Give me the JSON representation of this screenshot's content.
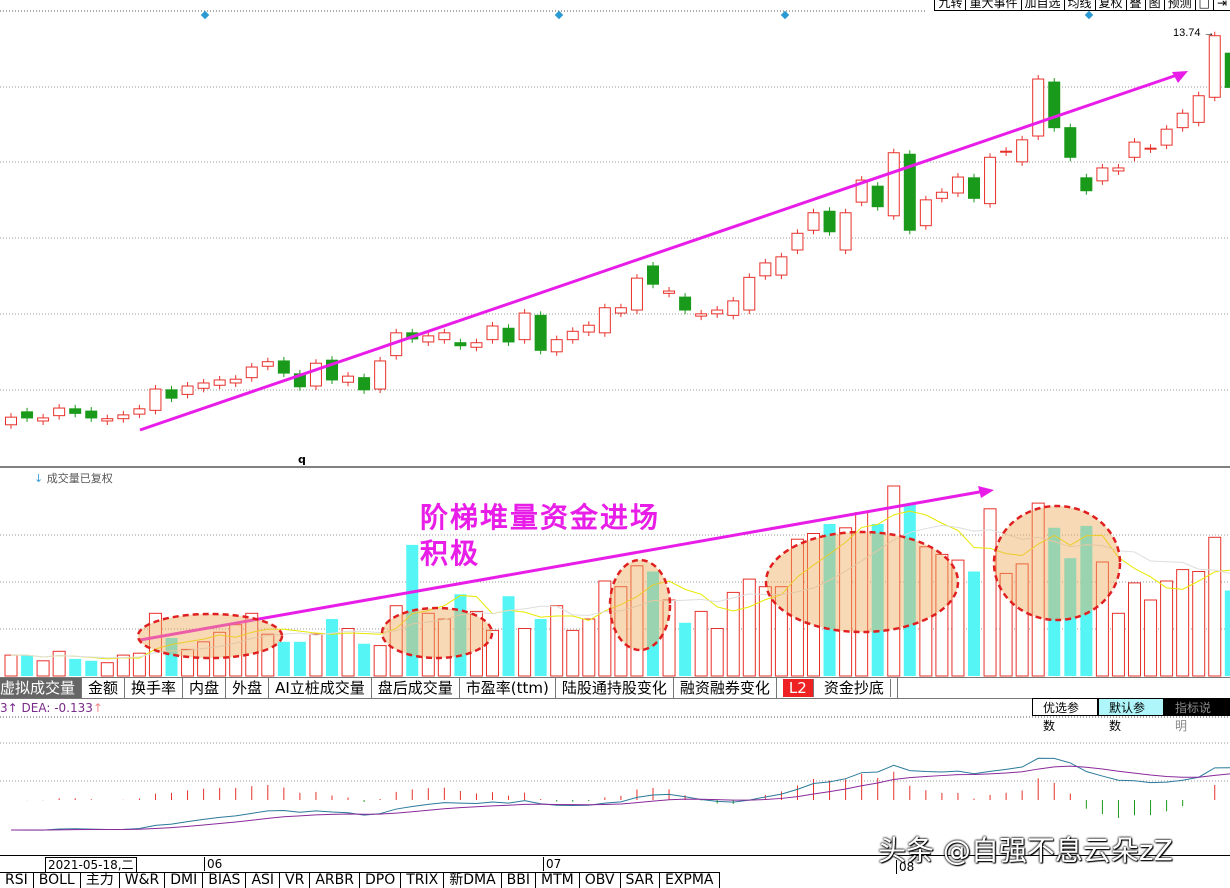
{
  "toolbar": [
    "九转",
    "重大事件",
    "加自选",
    "均线",
    "复权",
    "叠",
    "图",
    "预测",
    "□",
    "⇥"
  ],
  "price": {
    "high_label": "13.74"
  },
  "volume": {
    "note": "成交量已复权",
    "note_icon": "↓"
  },
  "marker": "q",
  "annotations": {
    "line1": "阶梯堆量资金进场",
    "line2": "积极"
  },
  "tabs": [
    "虚拟成交量",
    "金额",
    "换手率",
    "内盘",
    "外盘",
    "AI立桩成交量",
    "盘后成交量",
    "市盈率(ttm)",
    "陆股通持股变化",
    "融资融券变化",
    "资金抄底"
  ],
  "tab_badge": "L2",
  "macd": {
    "dif_tail": "3↑",
    "dea": "DEA: -0.133",
    "dea_arrow": "↑"
  },
  "param_buttons": [
    "优选参数",
    "默认参数",
    "指标说明"
  ],
  "date": {
    "cursor": "2021-05-18,二",
    "ticks": [
      "06",
      "07",
      "08"
    ]
  },
  "bottom_tabs": [
    "RSI",
    "BOLL",
    "主力",
    "W&R",
    "DMI",
    "BIAS",
    "ASI",
    "VR",
    "ARBR",
    "DPO",
    "TRIX",
    "新DMA",
    "BBI",
    "MTM",
    "OBV",
    "SAR",
    "EXPMA"
  ],
  "watermark": "头条 @自强不息云朵zZ",
  "colors": {
    "up": "#e8302a",
    "down": "#1a9a1a",
    "vol_down": "#55f5f5",
    "arrow": "#e81ee8"
  },
  "chart_data": {
    "type": "candlestick",
    "candles_open_close": [
      [
        8.61,
        8.71
      ],
      [
        8.78,
        8.7
      ],
      [
        8.66,
        8.7
      ],
      [
        8.73,
        8.83
      ],
      [
        8.82,
        8.76
      ],
      [
        8.79,
        8.7
      ],
      [
        8.66,
        8.69
      ],
      [
        8.69,
        8.74
      ],
      [
        8.75,
        8.82
      ],
      [
        8.8,
        9.08
      ],
      [
        9.07,
        8.96
      ],
      [
        9.01,
        9.12
      ],
      [
        9.09,
        9.16
      ],
      [
        9.13,
        9.2
      ],
      [
        9.16,
        9.21
      ],
      [
        9.23,
        9.37
      ],
      [
        9.38,
        9.44
      ],
      [
        9.45,
        9.29
      ],
      [
        9.28,
        9.11
      ],
      [
        9.12,
        9.42
      ],
      [
        9.46,
        9.2
      ],
      [
        9.17,
        9.25
      ],
      [
        9.23,
        9.07
      ],
      [
        9.08,
        9.45
      ],
      [
        9.52,
        9.82
      ],
      [
        9.82,
        9.74
      ],
      [
        9.7,
        9.78
      ],
      [
        9.73,
        9.82
      ],
      [
        9.69,
        9.65
      ],
      [
        9.63,
        9.69
      ],
      [
        9.73,
        9.91
      ],
      [
        9.88,
        9.7
      ],
      [
        9.73,
        10.08
      ],
      [
        10.05,
        9.59
      ],
      [
        9.57,
        9.73
      ],
      [
        9.73,
        9.84
      ],
      [
        9.83,
        9.92
      ],
      [
        9.82,
        10.15
      ],
      [
        10.08,
        10.15
      ],
      [
        10.12,
        10.54
      ],
      [
        10.7,
        10.46
      ],
      [
        10.34,
        10.37
      ],
      [
        10.29,
        10.12
      ],
      [
        10.04,
        10.07
      ],
      [
        10.07,
        10.12
      ],
      [
        10.05,
        10.24
      ],
      [
        10.12,
        10.55
      ],
      [
        10.57,
        10.74
      ],
      [
        10.58,
        10.82
      ],
      [
        10.91,
        11.13
      ],
      [
        11.17,
        11.4
      ],
      [
        11.42,
        11.15
      ],
      [
        10.91,
        11.4
      ],
      [
        11.54,
        11.83
      ],
      [
        11.75,
        11.48
      ],
      [
        11.36,
        12.19
      ],
      [
        12.17,
        11.17
      ],
      [
        11.23,
        11.57
      ],
      [
        11.59,
        11.67
      ],
      [
        11.66,
        11.87
      ],
      [
        11.86,
        11.59
      ],
      [
        11.52,
        12.13
      ],
      [
        12.2,
        12.21
      ],
      [
        12.07,
        12.36
      ],
      [
        12.41,
        13.16
      ],
      [
        13.12,
        12.52
      ],
      [
        12.52,
        12.13
      ],
      [
        11.86,
        11.69
      ],
      [
        11.82,
        11.99
      ],
      [
        11.95,
        11.99
      ],
      [
        12.13,
        12.33
      ],
      [
        12.24,
        12.25
      ],
      [
        12.29,
        12.5
      ],
      [
        12.52,
        12.71
      ],
      [
        12.59,
        12.94
      ],
      [
        12.92,
        13.73
      ],
      [
        13.5,
        13.05
      ]
    ],
    "volume": [
      11,
      11,
      8,
      13,
      9,
      8,
      7,
      11,
      12,
      33,
      20,
      14,
      18,
      23,
      27,
      33,
      22,
      18,
      18,
      22,
      30,
      25,
      17,
      16,
      37,
      69,
      33,
      30,
      43,
      34,
      24,
      42,
      25,
      30,
      37,
      24,
      30,
      50,
      47,
      58,
      55,
      40,
      28,
      34,
      25,
      44,
      51,
      47,
      47,
      72,
      75,
      80,
      78,
      86,
      80,
      100,
      90,
      68,
      64,
      61,
      55,
      88,
      54,
      59,
      91,
      78,
      62,
      79,
      60,
      33,
      49,
      40,
      50,
      56,
      55,
      73,
      45
    ],
    "price_range": [
      8.4,
      14.0
    ]
  }
}
